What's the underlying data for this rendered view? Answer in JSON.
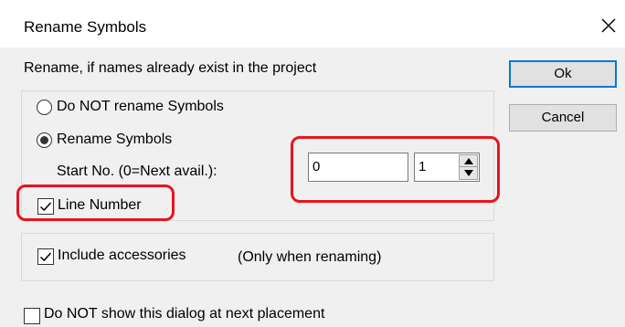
{
  "window": {
    "title": "Rename Symbols",
    "close_glyph": "✕"
  },
  "rename_header": "Rename, if names already exist in the project",
  "options": {
    "do_not_rename_label": "Do NOT rename Symbols",
    "do_not_rename_selected": false,
    "rename_label": "Rename Symbols",
    "rename_selected": true,
    "start_no_label": "Start No. (0=Next avail.):",
    "start_no_value": "0",
    "increment_value": "1",
    "line_number_label": "Line Number",
    "line_number_checked": true
  },
  "accessories": {
    "include_label": "Include accessories",
    "include_checked": true,
    "note": "(Only when renaming)"
  },
  "footer": {
    "do_not_show_label": "Do NOT show this dialog at next placement",
    "do_not_show_checked": false
  },
  "buttons": {
    "ok_label": "Ok",
    "cancel_label": "Cancel"
  },
  "colors": {
    "highlight": "#e8141e",
    "accent": "#0078d7",
    "dialog_bg": "#f0f0f0"
  }
}
